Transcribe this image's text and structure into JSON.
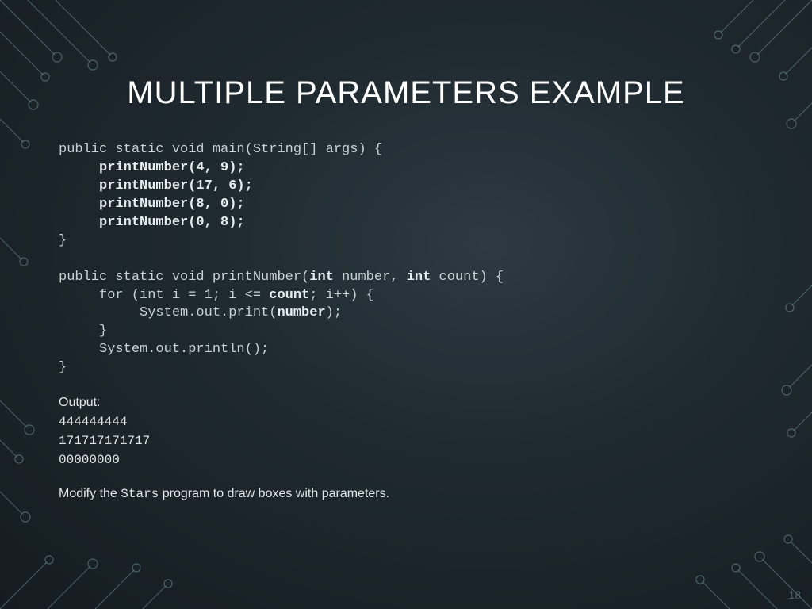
{
  "title": "MULTIPLE PARAMETERS EXAMPLE",
  "code": {
    "l1": "public static void main(String[] args) {",
    "l2": "     printNumber(4, 9);",
    "l3": "     printNumber(17, 6);",
    "l4": "     printNumber(8, 0);",
    "l5": "     printNumber(0, 8);",
    "l6": "}",
    "l7": "",
    "l8a": "public static void printNumber(",
    "l8b": "int",
    "l8c": " number, ",
    "l8d": "int",
    "l8e": " count",
    "l8f": ") {",
    "l9a": "     for (int i = 1; i <= ",
    "l9b": "count",
    "l9c": "; i++) {",
    "l10a": "          System.out.print(",
    "l10b": "number",
    "l10c": ");",
    "l11": "     }",
    "l12": "     System.out.println();",
    "l13": "}"
  },
  "output": {
    "label": "Output:",
    "line1": "444444444",
    "line2": "171717171717",
    "line3": "",
    "line4": "00000000"
  },
  "instruction": {
    "pre": "Modify the ",
    "prog": "Stars",
    "post": " program to draw boxes with parameters."
  },
  "pagenum": "18"
}
